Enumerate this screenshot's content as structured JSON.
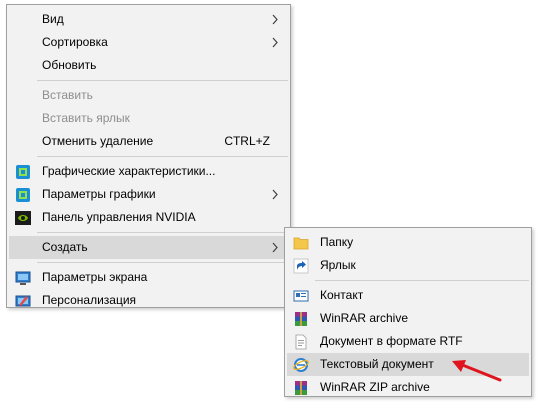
{
  "main_menu": {
    "items": [
      {
        "label": "Вид",
        "has_submenu": true
      },
      {
        "label": "Сортировка",
        "has_submenu": true
      },
      {
        "label": "Обновить"
      },
      {
        "label": "Вставить",
        "disabled": true
      },
      {
        "label": "Вставить ярлык",
        "disabled": true
      },
      {
        "label": "Отменить удаление",
        "shortcut": "CTRL+Z"
      },
      {
        "label": "Графические характеристики...",
        "icon": "intel-graphics-icon"
      },
      {
        "label": "Параметры графики",
        "icon": "intel-graphics-icon",
        "has_submenu": true
      },
      {
        "label": "Панель управления NVIDIA",
        "icon": "nvidia-icon"
      },
      {
        "label": "Создать",
        "has_submenu": true,
        "highlighted": true
      },
      {
        "label": "Параметры экрана",
        "icon": "display-icon"
      },
      {
        "label": "Персонализация",
        "icon": "personalization-icon"
      }
    ]
  },
  "sub_menu": {
    "items": [
      {
        "label": "Папку",
        "icon": "folder-icon"
      },
      {
        "label": "Ярлык",
        "icon": "shortcut-icon"
      },
      {
        "label": "Контакт",
        "icon": "contact-icon"
      },
      {
        "label": "WinRAR archive",
        "icon": "winrar-icon"
      },
      {
        "label": "Документ в формате RTF",
        "icon": "rtf-document-icon"
      },
      {
        "label": "Текстовый документ",
        "icon": "text-document-icon",
        "highlighted": true
      },
      {
        "label": "WinRAR ZIP archive",
        "icon": "winrar-zip-icon"
      }
    ]
  },
  "colors": {
    "menu_bg": "#f2f2f2",
    "highlight": "#d9d9d9",
    "disabled_text": "#8e8e8e",
    "pointer_arrow": "#e0141e"
  }
}
